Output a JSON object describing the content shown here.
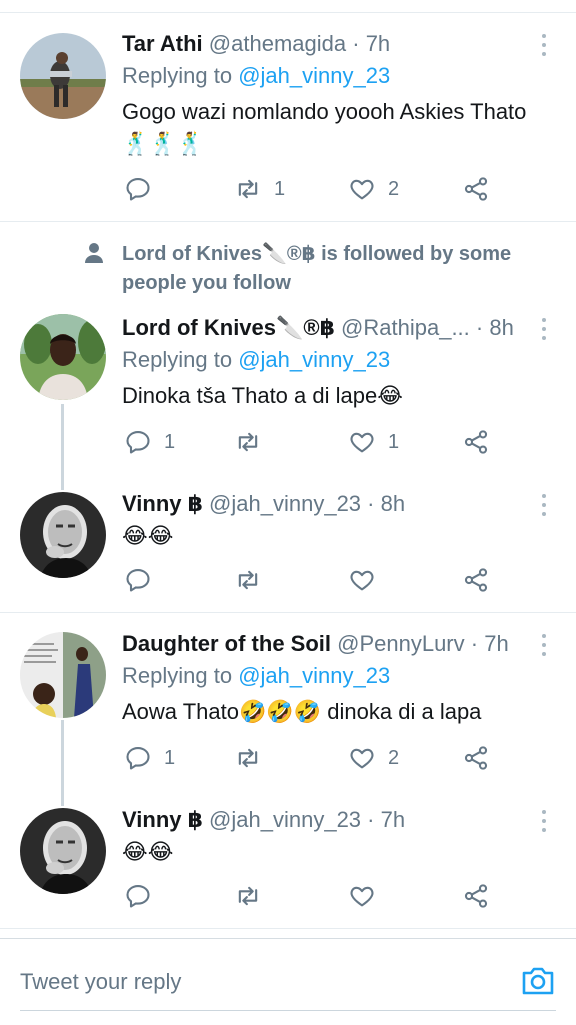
{
  "tweets": [
    {
      "name": "Tar Athi",
      "handle": "@athemagida",
      "dot": "·",
      "time": "7h",
      "replying_prefix": "Replying to",
      "replying_to": "@jah_vinny_23",
      "text": "Gogo wazi nomlando yoooh Askies Thato 🕺🕺🕺",
      "replies": "",
      "retweets": "1",
      "likes": "2"
    },
    {
      "name": "Lord of Knives🔪®฿",
      "handle": "@Rathipa_...",
      "dot": "·",
      "time": "8h",
      "replying_prefix": "Replying to",
      "replying_to": "@jah_vinny_23",
      "text": "Dinoka tša Thato a di lape😂",
      "replies": "1",
      "retweets": "",
      "likes": "1"
    },
    {
      "name": "Vinny ฿",
      "handle": "@jah_vinny_23",
      "dot": "·",
      "time": "8h",
      "text": "😂😂",
      "replies": "",
      "retweets": "",
      "likes": ""
    },
    {
      "name": "Daughter of the Soil",
      "handle": "@PennyLurv",
      "dot": "·",
      "time": "7h",
      "replying_prefix": "Replying to",
      "replying_to": "@jah_vinny_23",
      "text": "Aowa Thato🤣🤣🤣 dinoka di a lapa",
      "replies": "1",
      "retweets": "",
      "likes": "2"
    },
    {
      "name": "Vinny ฿",
      "handle": "@jah_vinny_23",
      "dot": "·",
      "time": "7h",
      "text": "😂😂",
      "replies": "",
      "retweets": "",
      "likes": ""
    }
  ],
  "social_context": "Lord of Knives🔪®฿ is followed by some people you follow",
  "reply_bar": {
    "placeholder": "Tweet your reply"
  },
  "colors": {
    "accent": "#1da1f2",
    "secondary_text": "#657786",
    "divider": "#e6ecf0"
  }
}
